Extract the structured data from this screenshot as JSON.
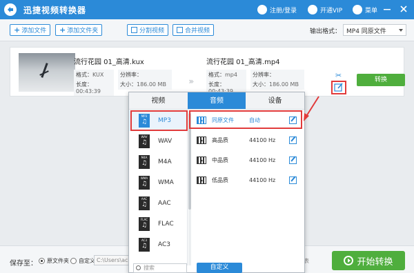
{
  "titlebar": {
    "app_title": "迅捷视频转换器",
    "login_label": "注册/登录",
    "vip_label": "开通VIP",
    "menu_label": "菜单",
    "bg_color": "#2b8ad8"
  },
  "toolbar": {
    "add_file": "添加文件",
    "add_folder": "添加文件夹",
    "split_video": "分割视频",
    "merge_video": "合并视频",
    "output_format_label": "输出格式：",
    "output_format_value": "MP4  同原文件"
  },
  "file": {
    "source_name": "流行花园 01_高清.kux",
    "source_format_label": "格式：",
    "source_format": "KUX",
    "source_resolution_label": "分辨率：",
    "source_duration_label": "长度：",
    "source_duration": "00:43:39",
    "source_size_label": "大小：",
    "source_size": "186.00 MB",
    "target_name": "流行花园 01_高清.mp4",
    "target_format_label": "格式：",
    "target_format": "mp4",
    "target_resolution_label": "分辨率：",
    "target_duration_label": "长度：",
    "target_duration": "00:43:39",
    "target_size_label": "大小：",
    "target_size": "186.00 MB",
    "convert_label": "转换"
  },
  "popup": {
    "tabs": [
      "视频",
      "音频",
      "设备"
    ],
    "active_tab": "音频",
    "formats": [
      {
        "badge": "MP3",
        "label": "MP3"
      },
      {
        "badge": "WAV",
        "label": "WAV"
      },
      {
        "badge": "M4A",
        "label": "M4A"
      },
      {
        "badge": "WMA",
        "label": "WMA"
      },
      {
        "badge": "AAC",
        "label": "AAC"
      },
      {
        "badge": "FLAC",
        "label": "FLAC"
      },
      {
        "badge": "AC3",
        "label": "AC3"
      }
    ],
    "selected_format": "MP3",
    "qualities": [
      {
        "name": "同原文件",
        "rate": "自动"
      },
      {
        "name": "高品质",
        "rate": "44100 Hz"
      },
      {
        "name": "中品质",
        "rate": "44100 Hz"
      },
      {
        "name": "低品质",
        "rate": "44100 Hz"
      }
    ],
    "search_placeholder": "搜索",
    "custom_label": "自定义"
  },
  "bottom": {
    "save_to_label": "保存至：",
    "option_original": "原文件夹",
    "option_custom": "自定义",
    "path_value": "C:\\Users\\ac",
    "right_text": "表",
    "start_label": "开始转换"
  },
  "colors": {
    "accent": "#2b8ad8",
    "green": "#4fae3d",
    "highlight": "#e13a3a"
  }
}
